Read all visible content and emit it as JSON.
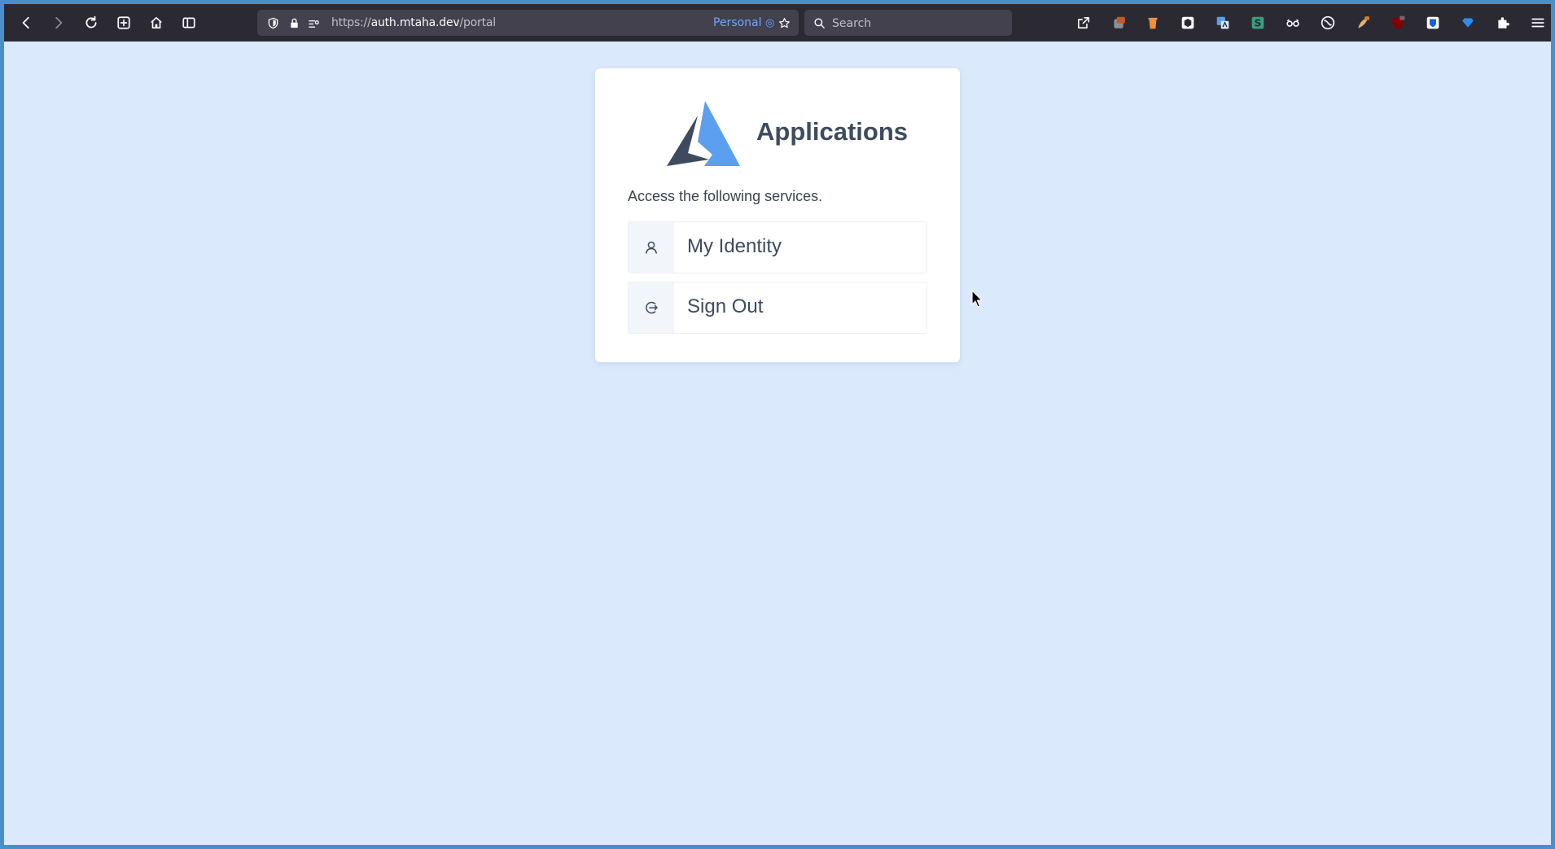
{
  "browser": {
    "url_scheme": "https://",
    "url_host": "auth.mtaha.dev",
    "url_path": "/portal",
    "container_label": "Personal",
    "search_placeholder": "Search"
  },
  "portal": {
    "title": "Applications",
    "subtitle": "Access the following services.",
    "apps": [
      {
        "label": "My Identity",
        "icon": "user-icon"
      },
      {
        "label": "Sign Out",
        "icon": "sign-out-icon"
      }
    ]
  },
  "colors": {
    "page_background": "#dbe9fc",
    "toolbar": "#2b2a33",
    "logo_light": "#5b9ff0",
    "logo_dark": "#3e4b5f",
    "text_primary": "#3e4b5f"
  }
}
